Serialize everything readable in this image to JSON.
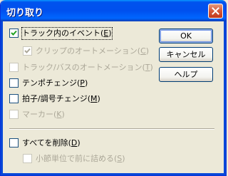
{
  "window": {
    "title": "切り取り"
  },
  "buttons": {
    "ok": "OK",
    "cancel": "キャンセル",
    "help": "ヘルプ"
  },
  "options": {
    "events_in_track": {
      "text": "トラック内のイベント(",
      "key": "E",
      "tail": ")",
      "checked": true,
      "enabled": true
    },
    "clip_automation": {
      "text": "クリップのオートメーション(",
      "key": "C",
      "tail": ")",
      "checked": true,
      "enabled": false
    },
    "track_bus_automation": {
      "text": "トラック/バスのオートメーション(",
      "key": "T",
      "tail": ")",
      "checked": false,
      "enabled": false
    },
    "tempo_change": {
      "text": "テンポチェンジ(",
      "key": "P",
      "tail": ")",
      "checked": false,
      "enabled": true
    },
    "meter_key_change": {
      "text": "拍子/調号チェンジ(",
      "key": "M",
      "tail": ")",
      "checked": false,
      "enabled": true
    },
    "markers": {
      "text": "マーカー(",
      "key": "K",
      "tail": ")",
      "checked": false,
      "enabled": false
    },
    "delete_all": {
      "text": "すべてを削除(",
      "key": "D",
      "tail": ")",
      "checked": false,
      "enabled": true
    },
    "shift_by_measure": {
      "text": "小節単位で前に詰める(",
      "key": "S",
      "tail": ")",
      "checked": false,
      "enabled": false
    }
  }
}
